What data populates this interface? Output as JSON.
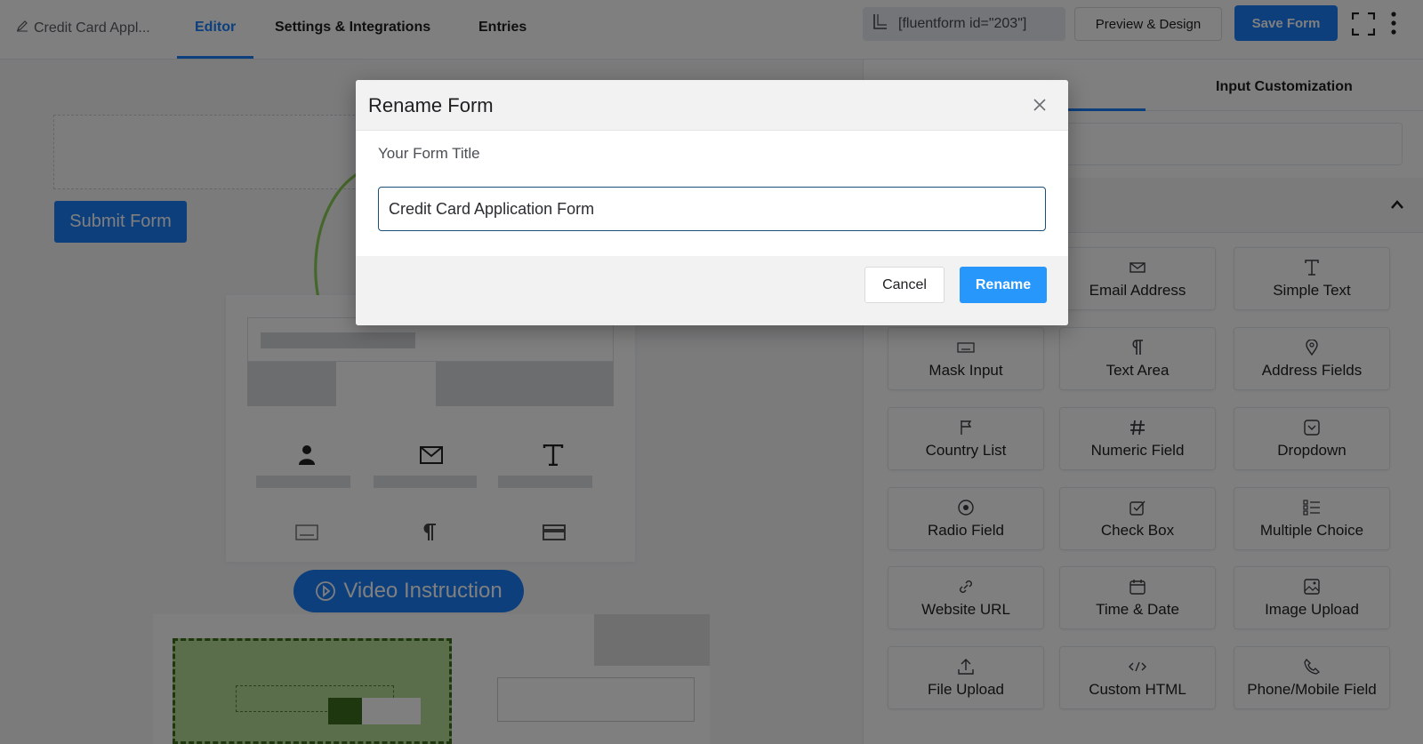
{
  "topbar": {
    "form_title": "Credit Card Appl...",
    "tabs": [
      {
        "label": "Editor",
        "active": true
      },
      {
        "label": "Settings & Integrations",
        "active": false
      },
      {
        "label": "Entries",
        "active": false
      }
    ],
    "shortcode": "[fluentform id=\"203\"]",
    "preview_label": "Preview & Design",
    "save_label": "Save Form"
  },
  "canvas": {
    "submit_label": "Submit Form",
    "video_label": "Video Instruction"
  },
  "panel": {
    "tab_input_customization": "Input Customization",
    "fields": [
      {
        "label": "Email Address",
        "icon": "envelope-icon"
      },
      {
        "label": "Simple Text",
        "icon": "text-icon"
      },
      {
        "label": "Mask Input",
        "icon": "keyboard-icon"
      },
      {
        "label": "Text Area",
        "icon": "paragraph-icon"
      },
      {
        "label": "Address Fields",
        "icon": "map-pin-icon"
      },
      {
        "label": "Country List",
        "icon": "flag-icon"
      },
      {
        "label": "Numeric Field",
        "icon": "hash-icon"
      },
      {
        "label": "Dropdown",
        "icon": "dropdown-icon"
      },
      {
        "label": "Radio Field",
        "icon": "radio-icon"
      },
      {
        "label": "Check Box",
        "icon": "checkbox-icon"
      },
      {
        "label": "Multiple Choice",
        "icon": "list-icon"
      },
      {
        "label": "Website URL",
        "icon": "link-icon"
      },
      {
        "label": "Time & Date",
        "icon": "calendar-icon"
      },
      {
        "label": "Image Upload",
        "icon": "image-icon"
      },
      {
        "label": "File Upload",
        "icon": "upload-icon"
      },
      {
        "label": "Custom HTML",
        "icon": "code-icon"
      },
      {
        "label": "Phone/Mobile Field",
        "icon": "phone-icon"
      }
    ]
  },
  "modal": {
    "title": "Rename Form",
    "field_label": "Your Form Title",
    "input_value": "Credit Card Application Form",
    "cancel_label": "Cancel",
    "rename_label": "Rename"
  },
  "colors": {
    "primary": "#1a7efb",
    "rename_button": "#2897fb",
    "overlay": "rgba(0,0,0,0.5)"
  }
}
